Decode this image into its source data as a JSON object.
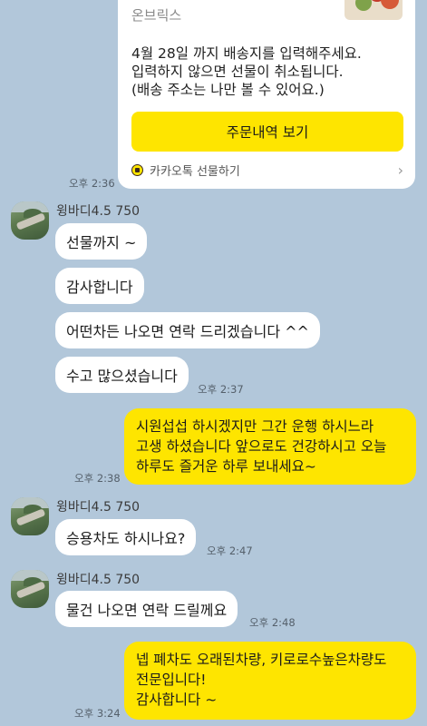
{
  "gift_card": {
    "brand": "온브릭스",
    "message": "4월 28일 까지 배송지를 입력해주세요.\n입력하지 않으면 선물이 취소됩니다.\n(배송 주소는 나만 볼 수 있어요.)",
    "button_label": "주문내역 보기",
    "footer_label": "카카오톡 선물하기",
    "time": "오후 2:36"
  },
  "group1": {
    "sender": "윙바디4.5 750",
    "messages": [
      "선물까지 ~",
      "감사합니다",
      "어떤차든 나오면 연락 드리겠습니다 ^^",
      "수고 많으셨습니다"
    ],
    "time": "오후 2:37"
  },
  "my_message1": {
    "text": "시원섭섭 하시겠지만 그간 운행 하시느라\n고생 하셨습니다 앞으로도 건강하시고 오늘\n하루도 즐거운 하루 보내세요~",
    "time": "오후 2:38"
  },
  "group2": {
    "sender": "윙바디4.5 750",
    "message": "승용차도 하시나요?",
    "time": "오후 2:47"
  },
  "group3": {
    "sender": "윙바디4.5 750",
    "message": "물건 나오면 연락 드릴께요",
    "time": "오후 2:48"
  },
  "my_message2": {
    "text": "넵 폐차도 오래된차량, 키로로수높은차량도\n전문입니다!\n감사합니다 ~",
    "time": "오후 3:24"
  },
  "colors": {
    "background": "#b2c7da",
    "my_bubble": "#fee500",
    "other_bubble": "#ffffff",
    "button": "#fee500"
  },
  "icons": [
    "gift-icon",
    "chevron-right-icon",
    "avatar-image"
  ]
}
